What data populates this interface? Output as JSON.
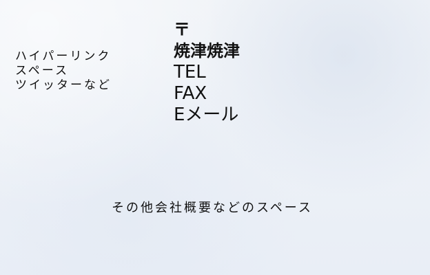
{
  "left_links": {
    "line1": "ハイパーリンク",
    "line2": "スペース",
    "line3": "ツイッターなど"
  },
  "contact": {
    "zip": "〒",
    "address": "焼津焼津",
    "tel": "TEL",
    "fax": "FAX",
    "email": "Eメール"
  },
  "company_info": {
    "text": "その他会社概要などのスペース"
  }
}
